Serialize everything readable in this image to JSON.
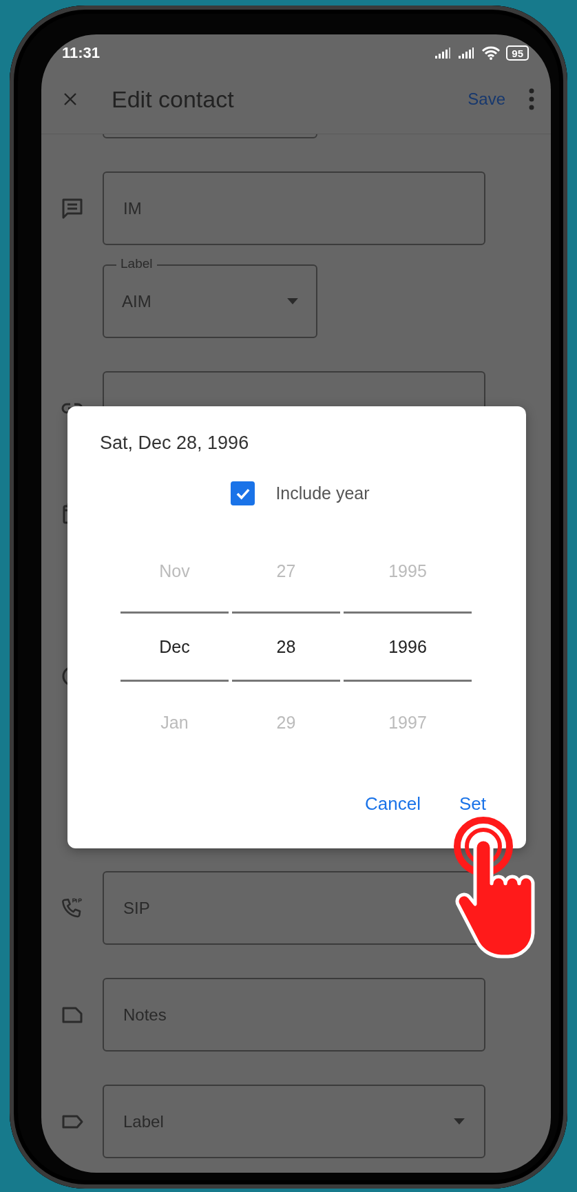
{
  "status_bar": {
    "time": "11:31",
    "battery": "95"
  },
  "toolbar": {
    "title": "Edit contact",
    "save_label": "Save"
  },
  "fields": [
    {
      "kind": "text",
      "placeholder": "IM"
    },
    {
      "kind": "select",
      "label": "Label",
      "value": "AIM"
    },
    {
      "kind": "text",
      "placeholder": "SIP"
    },
    {
      "kind": "text",
      "placeholder": "Notes"
    },
    {
      "kind": "select",
      "placeholder": "Label"
    }
  ],
  "dialog": {
    "title": "Sat, Dec 28, 1996",
    "include_year": {
      "label": "Include year",
      "checked": true
    },
    "columns": [
      {
        "items": [
          {
            "text": "Nov",
            "selected": false
          },
          {
            "text": "Dec",
            "selected": true
          },
          {
            "text": "Jan",
            "selected": false
          }
        ]
      },
      {
        "items": [
          {
            "text": "27",
            "selected": false
          },
          {
            "text": "28",
            "selected": true
          },
          {
            "text": "29",
            "selected": false
          }
        ]
      },
      {
        "items": [
          {
            "text": "1995",
            "selected": false
          },
          {
            "text": "1996",
            "selected": true
          },
          {
            "text": "1997",
            "selected": false
          }
        ]
      }
    ],
    "buttons": [
      "Cancel",
      "Set"
    ]
  }
}
